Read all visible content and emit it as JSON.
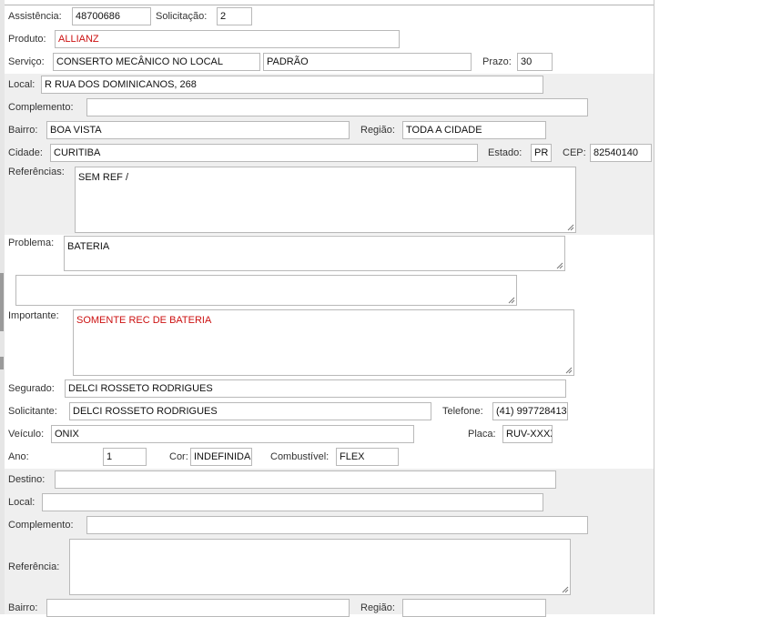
{
  "assistencia": {
    "label": "Assistência:",
    "value": "48700686"
  },
  "solicitacao": {
    "label": "Solicitação:",
    "value": "2"
  },
  "produto": {
    "label": "Produto:",
    "value": "ALLIANZ"
  },
  "servico": {
    "label": "Serviço:",
    "value": "CONSERTO MECÂNICO NO LOCAL",
    "tipo": "PADRÃO"
  },
  "prazo": {
    "label": "Prazo:",
    "value": "30"
  },
  "local": {
    "label": "Local:",
    "value": "R RUA DOS DOMINICANOS, 268"
  },
  "complemento": {
    "label": "Complemento:",
    "value": ""
  },
  "bairro": {
    "label": "Bairro:",
    "value": "BOA VISTA"
  },
  "regiao": {
    "label": "Região:",
    "value": "TODA A CIDADE"
  },
  "cidade": {
    "label": "Cidade:",
    "value": "CURITIBA"
  },
  "estado": {
    "label": "Estado:",
    "value": "PR"
  },
  "cep": {
    "label": "CEP:",
    "value": "82540140"
  },
  "referencias": {
    "label": "Referências:",
    "value": "SEM REF /"
  },
  "problema": {
    "label": "Problema:",
    "value": "BATERIA",
    "extra": ""
  },
  "importante": {
    "label": "Importante:",
    "value": "SOMENTE REC DE BATERIA"
  },
  "segurado": {
    "label": "Segurado:",
    "value": "DELCI ROSSETO RODRIGUES"
  },
  "solicitante": {
    "label": "Solicitante:",
    "value": "DELCI ROSSETO RODRIGUES"
  },
  "telefone": {
    "label": "Telefone:",
    "value": "(41) 997728413"
  },
  "veiculo": {
    "label": "Veículo:",
    "value": "ONIX"
  },
  "placa": {
    "label": "Placa:",
    "value": "RUV-XXXX"
  },
  "ano": {
    "label": "Ano:",
    "value": "1"
  },
  "cor": {
    "label": "Cor:",
    "value": "INDEFINIDA"
  },
  "combustivel": {
    "label": "Combustível:",
    "value": "FLEX"
  },
  "destino": {
    "destino_label": "Destino:",
    "destino_value": "",
    "local_label": "Local:",
    "local_value": "",
    "complemento_label": "Complemento:",
    "complemento_value": "",
    "referencia_label": "Referência:",
    "referencia_value": "",
    "bairro_label": "Bairro:",
    "bairro_value": "",
    "regiao_label": "Região:",
    "regiao_value": ""
  },
  "colors": {
    "accent_red": "#cc1111",
    "band": "#efefef",
    "border": "#b9b9b9"
  }
}
